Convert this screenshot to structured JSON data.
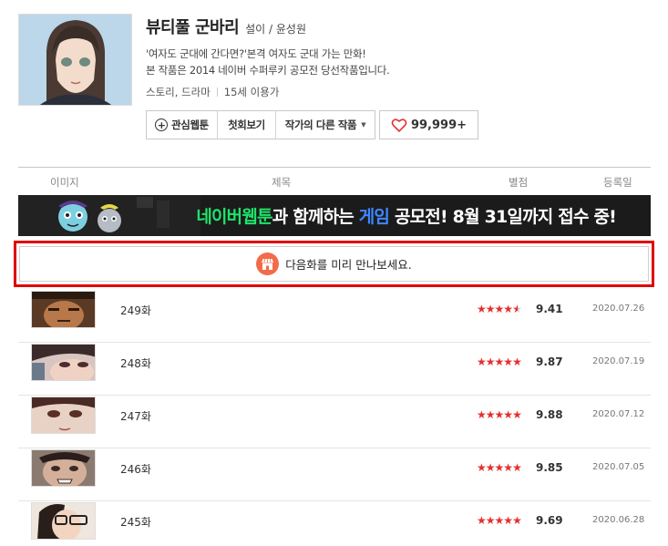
{
  "webtoon": {
    "title": "뷰티풀 군바리",
    "author": "설이 / 윤성원",
    "description_line1": "'여자도 군대에 간다면?'본격 여자도 군대 가는 만화!",
    "description_line2": "본 작품은 2014 네이버 수퍼루키 공모전 당선작품입니다.",
    "genre": "스토리, 드라마",
    "age": "15세 이용가"
  },
  "buttons": {
    "favorite": "관심웹툰",
    "first_episode": "첫회보기",
    "other_works": "작가의 다른 작품",
    "likes": "99,999+"
  },
  "table_headers": {
    "image": "이미지",
    "title": "제목",
    "rating": "별점",
    "date": "등록일"
  },
  "banner": {
    "part1": "네이버웹툰",
    "part2": "과 함께하는 ",
    "part3": "게임",
    "part4": " 공모전! 8월 31일까지 접수 중!"
  },
  "preview_text": "다음화를 미리 만나보세요.",
  "episodes": [
    {
      "title": "249화",
      "rating": "9.41",
      "stars": 4.7,
      "date": "2020.07.26"
    },
    {
      "title": "248화",
      "rating": "9.87",
      "stars": 4.93,
      "date": "2020.07.19"
    },
    {
      "title": "247화",
      "rating": "9.88",
      "stars": 4.94,
      "date": "2020.07.12"
    },
    {
      "title": "246화",
      "rating": "9.85",
      "stars": 4.93,
      "date": "2020.07.05"
    },
    {
      "title": "245화",
      "rating": "9.69",
      "stars": 4.85,
      "date": "2020.06.28"
    }
  ],
  "colors": {
    "accent_red": "#e52f2f",
    "highlight_border": "#e00000",
    "banner_green": "#1fe36a",
    "banner_blue": "#3d87ff",
    "store_icon_bg": "#f26b4a"
  },
  "icons": {
    "plus": "plus-circle-icon",
    "caret": "caret-down-icon",
    "heart": "heart-icon",
    "store": "store-icon",
    "star": "star-icon"
  }
}
